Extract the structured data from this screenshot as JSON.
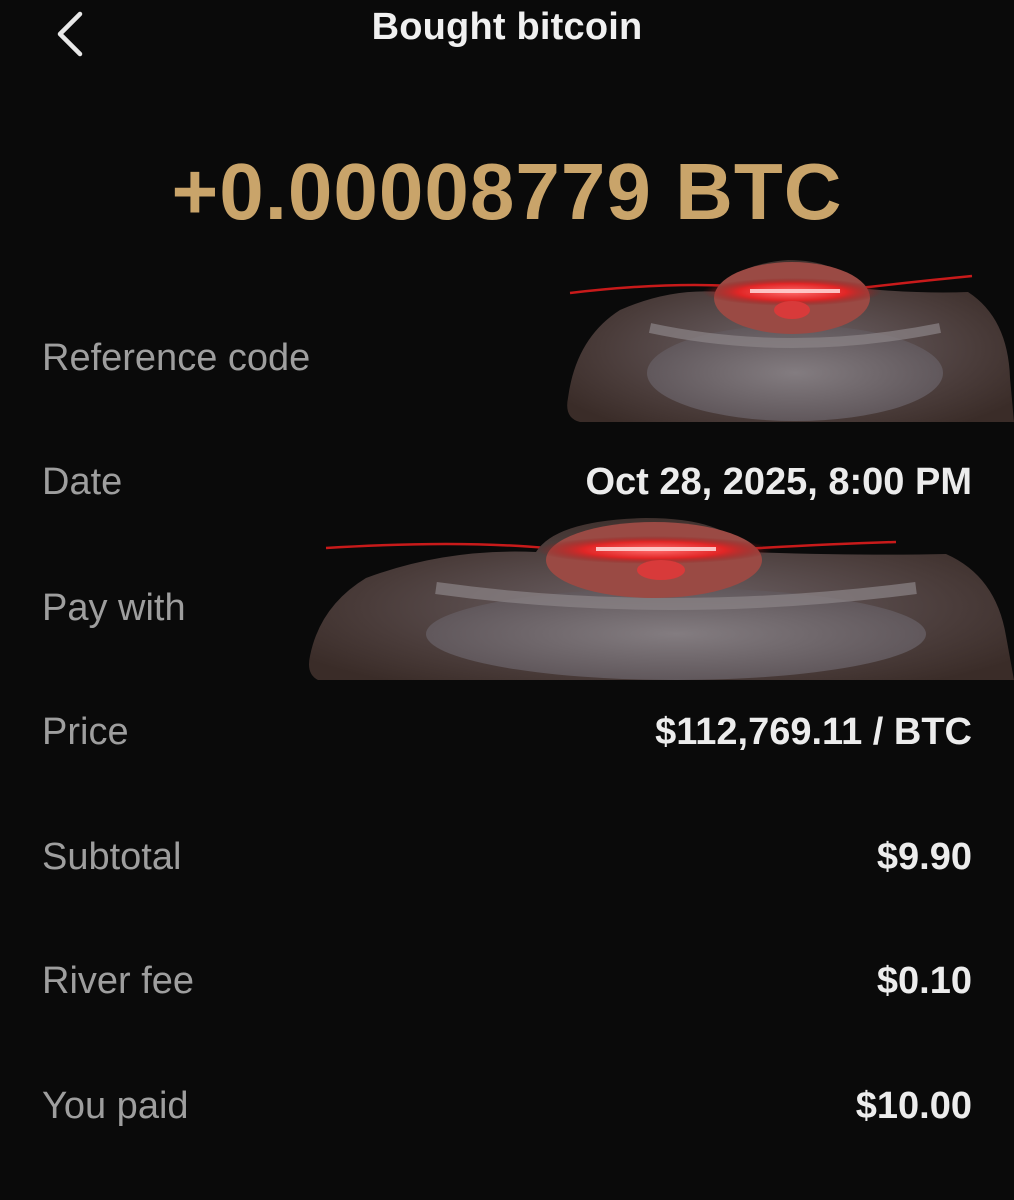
{
  "header": {
    "back_icon": "chevron-left-icon",
    "title": "Bought bitcoin"
  },
  "amount": "+0.00008779 BTC",
  "colors": {
    "background": "#0a0a0a",
    "accent_gold": "#c9a46a",
    "label_gray": "#9e9e9e",
    "value_white": "#ececec"
  },
  "details": {
    "reference_code": {
      "label": "Reference code",
      "value": ""
    },
    "date": {
      "label": "Date",
      "value": "Oct 28, 2025, 8:00 PM"
    },
    "pay_with": {
      "label": "Pay with",
      "value": ""
    },
    "price": {
      "label": "Price",
      "value": "$112,769.11 / BTC"
    },
    "subtotal": {
      "label": "Subtotal",
      "value": "$9.90"
    },
    "river_fee": {
      "label": "River fee",
      "value": "$0.10"
    },
    "you_paid": {
      "label": "You paid",
      "value": "$10.00"
    }
  }
}
